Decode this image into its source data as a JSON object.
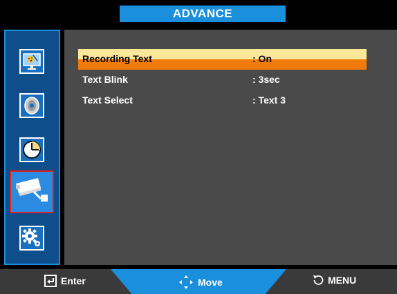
{
  "title": "ADVANCE",
  "sidebar": {
    "items": [
      {
        "name": "picture",
        "icon": "picture-icon"
      },
      {
        "name": "sound",
        "icon": "speaker-icon"
      },
      {
        "name": "time",
        "icon": "clock-icon"
      },
      {
        "name": "advance",
        "icon": "camera-icon",
        "selected": true
      },
      {
        "name": "setup",
        "icon": "gear-icon"
      }
    ]
  },
  "menu": {
    "rows": [
      {
        "label": "Recording Text",
        "value": ": On",
        "highlighted": true
      },
      {
        "label": "Text Blink",
        "value": ": 3sec"
      },
      {
        "label": "Text Select",
        "value": ": Text 3"
      }
    ]
  },
  "footer": {
    "enter": "Enter",
    "move": "Move",
    "menu": "MENU"
  },
  "colors": {
    "accent": "#1a8fdc",
    "highlight_top": "#f9e79a",
    "highlight_bottom": "#f07b0a",
    "panel": "#4a4a4a"
  }
}
